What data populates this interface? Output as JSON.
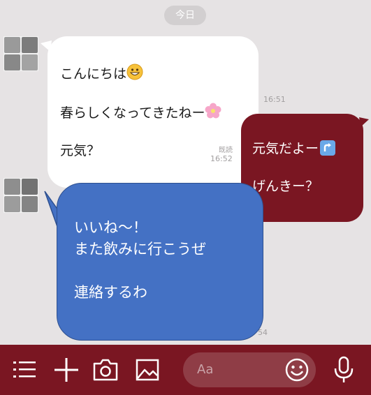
{
  "date_divider": "今日",
  "messages": [
    {
      "sender": "friend",
      "lines": [
        "こんにちは",
        "春らしくなってきたねー",
        "元気？"
      ],
      "emojis": [
        "grinning-face-emoji",
        "cherry-blossom-emoji"
      ],
      "time": "16:51"
    },
    {
      "sender": "me",
      "lines": [
        "元気だよー",
        "げんきー？"
      ],
      "icon": "arrow-up-box-icon",
      "read_label": "既読",
      "time": "16:52"
    },
    {
      "sender": "friend",
      "text": "いいね〜！\nまた飲みに行こうぜ\n\n連絡するわ",
      "time_partial": "54"
    }
  ],
  "toolbar": {
    "icons": [
      "menu-icon",
      "plus-icon",
      "camera-icon",
      "image-icon",
      "emoji-icon",
      "microphone-icon"
    ],
    "input_placeholder": "Aa"
  },
  "colors": {
    "background": "#e6e3e4",
    "outgoing_bubble": "#7a1622",
    "incoming_bubble": "#ffffff",
    "highlight_bubble": "#4471c4",
    "toolbar": "#7a1622"
  }
}
